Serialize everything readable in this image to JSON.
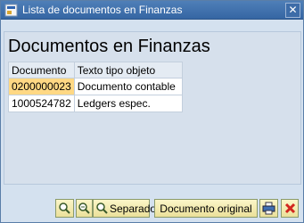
{
  "window": {
    "title": "Lista de documentos en Finanzas"
  },
  "panel": {
    "heading": "Documentos en Finanzas"
  },
  "table": {
    "columns": [
      "Documento",
      "Texto tipo objeto"
    ],
    "rows": [
      [
        "0200000023",
        "Documento contable"
      ],
      [
        "1000524782",
        "Ledgers espec."
      ]
    ],
    "selected_row": 0
  },
  "footer": {
    "separado_label": "Separado",
    "original_label": "Documento original"
  },
  "icons": {
    "title": "sap-window-icon",
    "close": "close-icon",
    "zoom1": "magnifier-icon",
    "zoom2": "magnifier-detail-icon",
    "print": "printer-icon",
    "cancel": "cancel-icon"
  },
  "colors": {
    "titlebar": "#3566a3",
    "selection": "#ffd884",
    "button": "#ebe09a",
    "cancel": "#d2261f"
  }
}
